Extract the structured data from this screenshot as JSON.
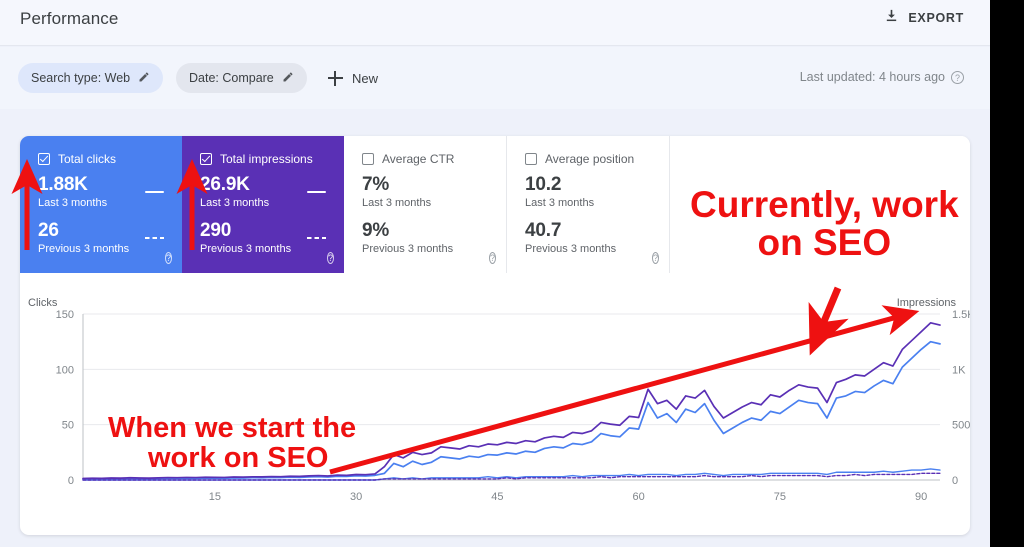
{
  "header": {
    "title": "Performance",
    "export_label": "EXPORT",
    "export_icon": "download-icon"
  },
  "filters": {
    "search_type_chip": "Search type: Web",
    "date_chip": "Date: Compare",
    "new_label": "New",
    "edit_icon": "pencil-icon",
    "add_icon": "plus-icon",
    "last_updated": "Last updated: 4 hours ago",
    "help_icon": "help-circle-icon"
  },
  "metrics": [
    {
      "name": "Total clicks",
      "checked": true,
      "current_value": "1.88K",
      "current_label": "Last 3 months",
      "previous_value": "26",
      "previous_label": "Previous 3 months",
      "color": "#4a80f0"
    },
    {
      "name": "Total impressions",
      "checked": true,
      "current_value": "26.9K",
      "current_label": "Last 3 months",
      "previous_value": "290",
      "previous_label": "Previous 3 months",
      "color": "#5a30b5"
    },
    {
      "name": "Average CTR",
      "checked": false,
      "current_value": "7%",
      "current_label": "Last 3 months",
      "previous_value": "9%",
      "previous_label": "Previous 3 months",
      "color": "#ffffff"
    },
    {
      "name": "Average position",
      "checked": false,
      "current_value": "10.2",
      "current_label": "Last 3 months",
      "previous_value": "40.7",
      "previous_label": "Previous 3 months",
      "color": "#ffffff"
    }
  ],
  "annotations": {
    "right_line1": "Currently, work",
    "right_line2": "on SEO",
    "left_line1": "When we start the",
    "left_line2": "work on SEO",
    "color": "#ee1111"
  },
  "chart_data": {
    "type": "line",
    "title": "",
    "xlabel": "",
    "ylabel": "Clicks",
    "y2label": "Impressions",
    "grid": true,
    "legend_position": "cards-above",
    "x": [
      1,
      2,
      3,
      4,
      5,
      6,
      7,
      8,
      9,
      10,
      11,
      12,
      13,
      14,
      15,
      16,
      17,
      18,
      19,
      20,
      21,
      22,
      23,
      24,
      25,
      26,
      27,
      28,
      29,
      30,
      31,
      32,
      33,
      34,
      35,
      36,
      37,
      38,
      39,
      40,
      41,
      42,
      43,
      44,
      45,
      46,
      47,
      48,
      49,
      50,
      51,
      52,
      53,
      54,
      55,
      56,
      57,
      58,
      59,
      60,
      61,
      62,
      63,
      64,
      65,
      66,
      67,
      68,
      69,
      70,
      71,
      72,
      73,
      74,
      75,
      76,
      77,
      78,
      79,
      80,
      81,
      82,
      83,
      84,
      85,
      86,
      87,
      88,
      89,
      90,
      91,
      92
    ],
    "xticks": [
      15,
      30,
      45,
      60,
      75,
      90
    ],
    "xlim": [
      1,
      92
    ],
    "ylim": [
      0,
      150
    ],
    "yticks": [
      0,
      50,
      100,
      150
    ],
    "y2lim": [
      0,
      1500
    ],
    "y2ticks": [
      "0",
      "500",
      "1K",
      "1.5K"
    ],
    "series": [
      {
        "name": "Total impressions",
        "axis": "right",
        "color": "#4a80f0",
        "style": "solid",
        "values": [
          8,
          10,
          9,
          12,
          11,
          14,
          12,
          10,
          13,
          15,
          14,
          16,
          15,
          18,
          17,
          16,
          19,
          18,
          21,
          20,
          23,
          22,
          26,
          24,
          28,
          30,
          27,
          34,
          32,
          38,
          36,
          42,
          60,
          150,
          120,
          170,
          140,
          160,
          210,
          200,
          190,
          215,
          205,
          230,
          225,
          245,
          235,
          260,
          250,
          285,
          300,
          290,
          330,
          320,
          345,
          420,
          400,
          390,
          470,
          460,
          700,
          560,
          600,
          520,
          640,
          610,
          690,
          540,
          420,
          470,
          520,
          560,
          540,
          620,
          600,
          660,
          720,
          700,
          690,
          560,
          740,
          760,
          800,
          790,
          850,
          900,
          870,
          1020,
          1100,
          1180,
          1250,
          1230
        ]
      },
      {
        "name": "Total impressions (previous period)",
        "axis": "right",
        "color": "#5a30b5",
        "style": "solid",
        "values": [
          14,
          16,
          15,
          18,
          17,
          20,
          18,
          17,
          19,
          22,
          21,
          23,
          22,
          25,
          24,
          23,
          27,
          26,
          29,
          28,
          31,
          30,
          34,
          33,
          37,
          40,
          36,
          44,
          42,
          50,
          48,
          55,
          120,
          230,
          200,
          250,
          230,
          245,
          300,
          290,
          280,
          310,
          300,
          325,
          318,
          340,
          330,
          355,
          345,
          380,
          395,
          385,
          430,
          420,
          445,
          520,
          505,
          495,
          575,
          565,
          820,
          690,
          720,
          640,
          760,
          740,
          810,
          665,
          560,
          610,
          660,
          700,
          680,
          770,
          750,
          810,
          860,
          840,
          830,
          700,
          880,
          910,
          950,
          940,
          1000,
          1060,
          1030,
          1180,
          1260,
          1340,
          1420,
          1400
        ]
      },
      {
        "name": "Total clicks",
        "axis": "left",
        "color": "#4a80f0",
        "style": "solid",
        "values": [
          0,
          0,
          0,
          0,
          0,
          0,
          0,
          0,
          0,
          0,
          0,
          0,
          0,
          0,
          0,
          0,
          0,
          0,
          0,
          0,
          0,
          0,
          0,
          0,
          0,
          0,
          0,
          0,
          0,
          0,
          0,
          0,
          1,
          2,
          1,
          2,
          1,
          2,
          2,
          2,
          2,
          2,
          2,
          3,
          2,
          3,
          2,
          3,
          3,
          3,
          3,
          3,
          4,
          3,
          4,
          4,
          4,
          4,
          5,
          4,
          5,
          5,
          5,
          4,
          5,
          5,
          6,
          5,
          4,
          5,
          5,
          5,
          5,
          6,
          6,
          6,
          6,
          6,
          6,
          5,
          7,
          7,
          7,
          7,
          7,
          8,
          7,
          8,
          9,
          9,
          10,
          9
        ]
      },
      {
        "name": "Total clicks (previous period)",
        "axis": "left",
        "color": "#5a30b5",
        "style": "dashed",
        "values": [
          0,
          0,
          0,
          0,
          0,
          0,
          0,
          0,
          0,
          0,
          0,
          0,
          0,
          0,
          0,
          0,
          0,
          0,
          0,
          0,
          0,
          0,
          0,
          0,
          0,
          0,
          0,
          0,
          0,
          0,
          0,
          0,
          1,
          1,
          1,
          1,
          1,
          1,
          1,
          1,
          1,
          1,
          1,
          1,
          1,
          2,
          1,
          2,
          2,
          2,
          2,
          2,
          2,
          2,
          2,
          3,
          2,
          3,
          3,
          3,
          3,
          3,
          3,
          3,
          3,
          3,
          4,
          3,
          3,
          3,
          3,
          4,
          3,
          4,
          4,
          4,
          4,
          4,
          4,
          3,
          4,
          4,
          5,
          4,
          5,
          5,
          5,
          5,
          5,
          6,
          6,
          6
        ]
      }
    ]
  }
}
